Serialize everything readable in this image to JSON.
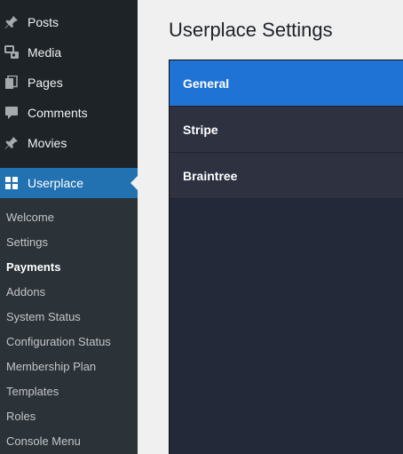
{
  "sidebar": {
    "menu": [
      {
        "label": "Posts",
        "icon": "pin-icon"
      },
      {
        "label": "Media",
        "icon": "media-icon"
      },
      {
        "label": "Pages",
        "icon": "pages-icon"
      },
      {
        "label": "Comments",
        "icon": "comment-icon"
      },
      {
        "label": "Movies",
        "icon": "pin-icon"
      }
    ],
    "active": {
      "label": "Userplace",
      "icon": "grid-icon"
    },
    "submenu": [
      "Welcome",
      "Settings",
      "Payments",
      "Addons",
      "System Status",
      "Configuration Status",
      "Membership Plan",
      "Templates",
      "Roles",
      "Console Menu"
    ],
    "current_submenu": "Payments"
  },
  "main": {
    "title": "Userplace Settings",
    "tabs": [
      "General",
      "Stripe",
      "Braintree"
    ],
    "selected_tab": "General"
  },
  "colors": {
    "sidebar_bg": "#1d2327",
    "accent": "#2271b1",
    "tab_active": "#1e73d4",
    "panel_bg": "#242939"
  }
}
